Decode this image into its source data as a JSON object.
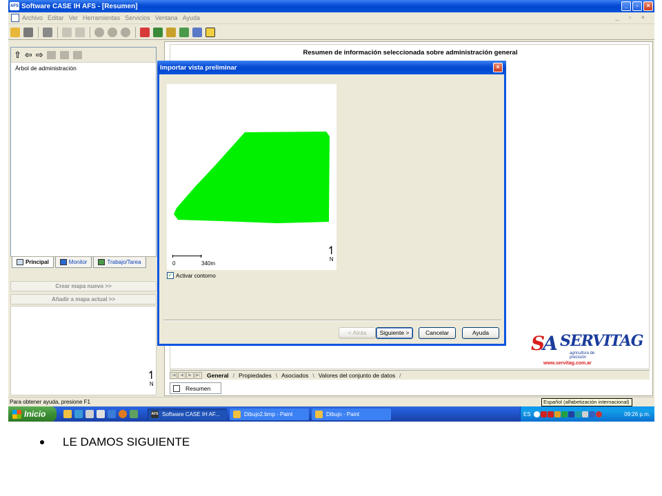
{
  "window": {
    "app_icon_text": "AFS",
    "title": "Software CASE IH AFS - [Resumen]",
    "mdi_buttons": "_ ▫ ×"
  },
  "menu": [
    "Archivo",
    "Editar",
    "Ver",
    "Herramientas",
    "Servicios",
    "Ventana",
    "Ayuda"
  ],
  "left_panel": {
    "tree_root": "Árbol de administración",
    "tabs": [
      {
        "label": "Principal",
        "active": true
      },
      {
        "label": "Monitor",
        "active": false
      },
      {
        "label": "Trabajo/Tarea",
        "active": false
      }
    ],
    "create_map_button": "Crear mapa nuevo  >>",
    "add_map_button": "Añadir a mapa actual  >>",
    "north_label": "N"
  },
  "main": {
    "title": "Resumen de información seleccionada sobre administración general",
    "sheet_tabs": [
      {
        "label": "General",
        "active": true
      },
      {
        "label": "Propiedades",
        "active": false
      },
      {
        "label": "Asociados",
        "active": false
      },
      {
        "label": "Valores del conjunto de datos",
        "active": false
      }
    ],
    "doc_tab": "Resumen",
    "north_label": "N"
  },
  "logo": {
    "mark_a": "S",
    "mark_b": "A",
    "name": "SERVITAG",
    "tagline": "agricultura de precisión",
    "website": "www.servitag.com.ar"
  },
  "dialog": {
    "title": "Importar vista preliminar",
    "scale_start": "0",
    "scale_distance": "340m",
    "north_label": "N",
    "checkbox_label": "Activar contorno",
    "checkbox_checked": true,
    "buttons": {
      "back": "< Atrás",
      "next": "Siguiente >",
      "cancel": "Cancelar",
      "help": "Ayuda"
    },
    "field_color": "#00f000"
  },
  "statusbar": {
    "text": "Para obtener ayuda, presione F1",
    "ime_tooltip": "Español (alfabetización internacional)"
  },
  "taskbar": {
    "start_label": "Inicio",
    "tasks": [
      {
        "label": "Software CASE IH AF...",
        "active": true,
        "icon": "AFS"
      },
      {
        "label": "Dibujo2.bmp - Paint",
        "active": false,
        "icon": ""
      },
      {
        "label": "Dibujo - Paint",
        "active": false,
        "icon": ""
      }
    ],
    "language": "ES",
    "clock": "09:26 p.m."
  },
  "caption": {
    "text": "LE DAMOS SIGUIENTE"
  }
}
